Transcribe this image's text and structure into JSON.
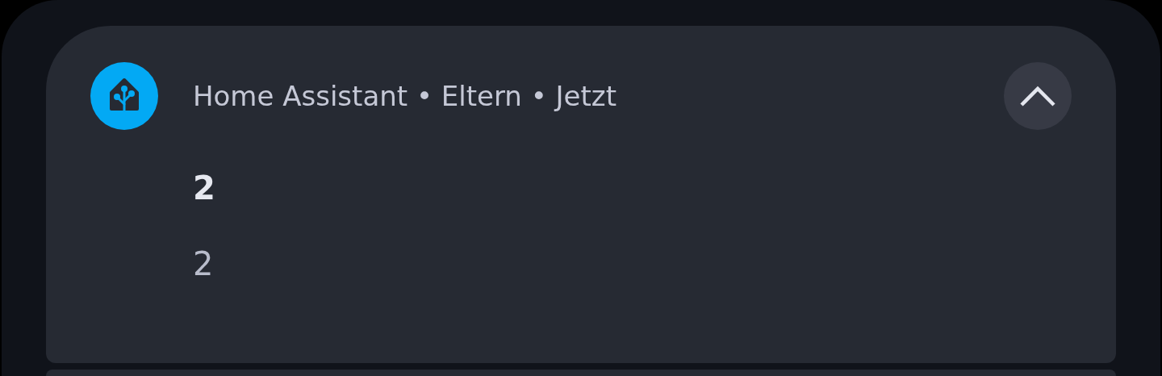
{
  "notification": {
    "header": "Home Assistant • Eltern • Jetzt",
    "expanded": true,
    "title": "2",
    "message": "2"
  }
}
